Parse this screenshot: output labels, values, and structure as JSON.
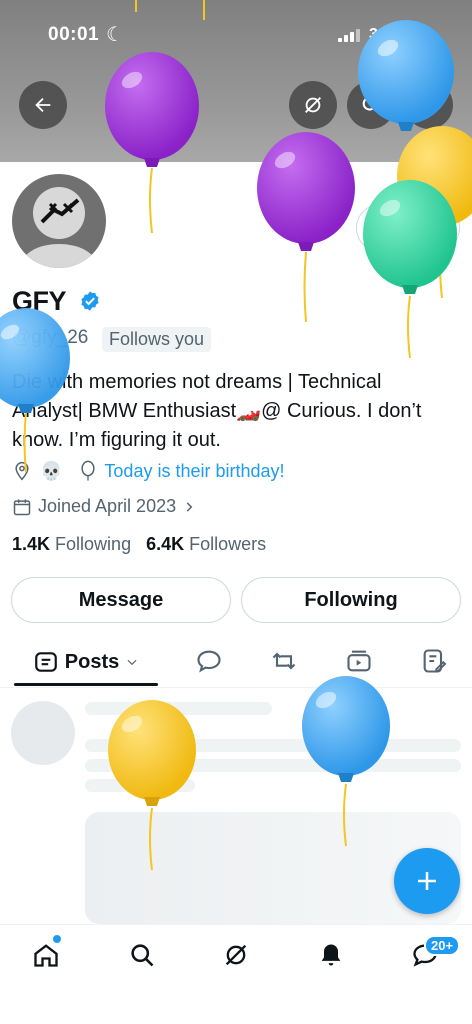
{
  "status_bar": {
    "time": "00:01",
    "network": "3G"
  },
  "profile": {
    "name": "GFY",
    "handle": "@gfy_26",
    "follows_you": "Follows you",
    "bio_line1": "Die with memories not dreams | Technical",
    "bio_line2": "Analyst| BMW Enthusiast",
    "bio_emoji": "🏎️",
    "bio_line2_end": "@ Curious. I don’t",
    "bio_line3": "know. I’m figuring it out.",
    "location_emoji": "💀",
    "birthday": "Today is their birthday!",
    "joined": "Joined April 2023",
    "following_count": "1.4K",
    "following_label": "Following",
    "followers_count": "6.4K",
    "followers_label": "Followers"
  },
  "actions": {
    "message": "Message",
    "following": "Following"
  },
  "tabs": {
    "posts": "Posts"
  },
  "bottom_nav": {
    "messages_badge": "20+"
  },
  "colors": {
    "accent": "#1d9bf0",
    "balloon_purple": "#9b30d9",
    "balloon_blue": "#3aa8f0",
    "balloon_yellow": "#f3c623",
    "balloon_green": "#2fd3a0"
  },
  "icons": [
    "back-arrow-icon",
    "grok-icon",
    "search-icon",
    "more-icon",
    "notification-bell-icon",
    "verified-badge-icon",
    "location-icon",
    "balloon-icon",
    "calendar-icon",
    "chevron-right-icon",
    "posts-icon",
    "chevron-down-icon",
    "reply-icon",
    "repost-icon",
    "video-icon",
    "articles-icon",
    "compose-plus-icon",
    "home-icon",
    "grok-icon",
    "bell-icon",
    "messages-icon"
  ]
}
